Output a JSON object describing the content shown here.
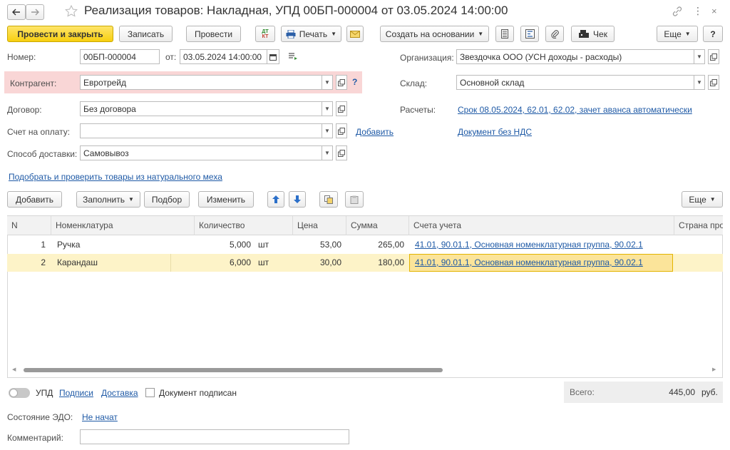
{
  "window": {
    "title": "Реализация товаров: Накладная, УПД 00БП-000004 от 03.05.2024 14:00:00"
  },
  "toolbar": {
    "post_close": "Провести и закрыть",
    "save": "Записать",
    "post": "Провести",
    "dt_kt": "Дт Кт",
    "print": "Печать",
    "create_based": "Создать на основании",
    "check": "Чек",
    "more": "Еще",
    "help": "?"
  },
  "form": {
    "number_label": "Номер:",
    "number_value": "00БП-000004",
    "date_label": "от:",
    "date_value": "03.05.2024 14:00:00",
    "org_label": "Организация:",
    "org_value": "Звездочка ООО (УСН доходы - расходы)",
    "contractor_label": "Контрагент:",
    "contractor_value": "Евротрейд",
    "warehouse_label": "Склад:",
    "warehouse_value": "Основной склад",
    "contract_label": "Договор:",
    "contract_value": "Без договора",
    "settlements_label": "Расчеты:",
    "settlements_link": "Срок 08.05.2024, 62.01, 62.02, зачет аванса автоматически",
    "invoice_label": "Счет на оплату:",
    "invoice_value": "",
    "invoice_add": "Добавить",
    "vat_link": "Документ без НДС",
    "delivery_label": "Способ доставки:",
    "delivery_value": "Самовывоз",
    "marking_link": "Подобрать и проверить товары из натурального меха",
    "help_mark": "?"
  },
  "table_toolbar": {
    "add": "Добавить",
    "fill": "Заполнить",
    "select": "Подбор",
    "change": "Изменить",
    "more": "Еще"
  },
  "table": {
    "columns": [
      "N",
      "Номенклатура",
      "Количество",
      "Цена",
      "Сумма",
      "Счета учета",
      "Страна про"
    ],
    "rows": [
      {
        "n": "1",
        "item": "Ручка",
        "qty": "5,000",
        "unit": "шт",
        "price": "53,00",
        "sum": "265,00",
        "accounts": "41.01, 90.01.1, Основная номенклатурная группа, 90.02.1"
      },
      {
        "n": "2",
        "item": "Карандаш",
        "qty": "6,000",
        "unit": "шт",
        "price": "30,00",
        "sum": "180,00",
        "accounts": "41.01, 90.01.1, Основная номенклатурная группа, 90.02.1"
      }
    ]
  },
  "footer": {
    "upd_label": "УПД",
    "signatures_link": "Подписи",
    "delivery_link": "Доставка",
    "signed_label": "Документ подписан",
    "total_label": "Всего:",
    "total_value": "445,00",
    "currency": "руб.",
    "edo_label": "Состояние ЭДО:",
    "edo_link": "Не начат",
    "comment_label": "Комментарий:",
    "comment_value": ""
  },
  "colors": {
    "primary_button": "#f7cf10",
    "highlight_row": "#fdf3c8",
    "contractor_bg": "#f9d6d6",
    "link": "#1f5aa6"
  }
}
